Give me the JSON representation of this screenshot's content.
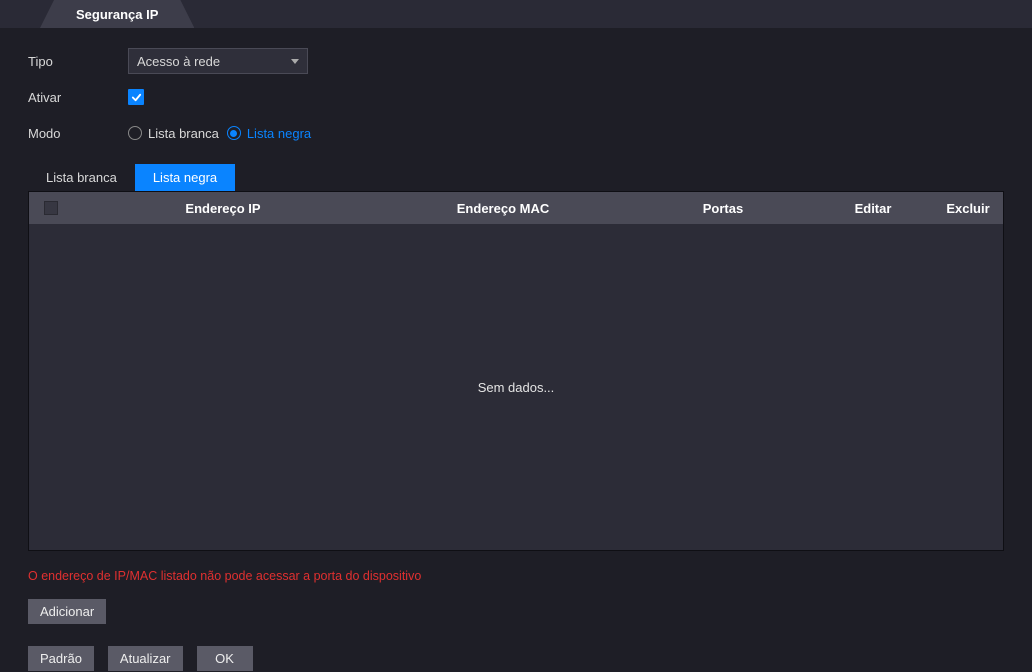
{
  "page_tab": "Segurança IP",
  "form": {
    "tipo_label": "Tipo",
    "tipo_value": "Acesso à rede",
    "ativar_label": "Ativar",
    "ativar_checked": true,
    "modo_label": "Modo",
    "modo_options": {
      "lista_branca": "Lista branca",
      "lista_negra": "Lista negra"
    },
    "modo_selected": "lista_negra"
  },
  "subtabs": {
    "lista_branca": "Lista branca",
    "lista_negra": "Lista negra",
    "active": "lista_negra"
  },
  "table": {
    "columns": {
      "ip": "Endereço IP",
      "mac": "Endereço MAC",
      "ports": "Portas",
      "edit": "Editar",
      "delete": "Excluir"
    },
    "empty_text": "Sem dados..."
  },
  "warning": "O endereço de IP/MAC listado não pode acessar a porta do dispositivo",
  "buttons": {
    "add": "Adicionar",
    "default": "Padrão",
    "refresh": "Atualizar",
    "ok": "OK"
  }
}
